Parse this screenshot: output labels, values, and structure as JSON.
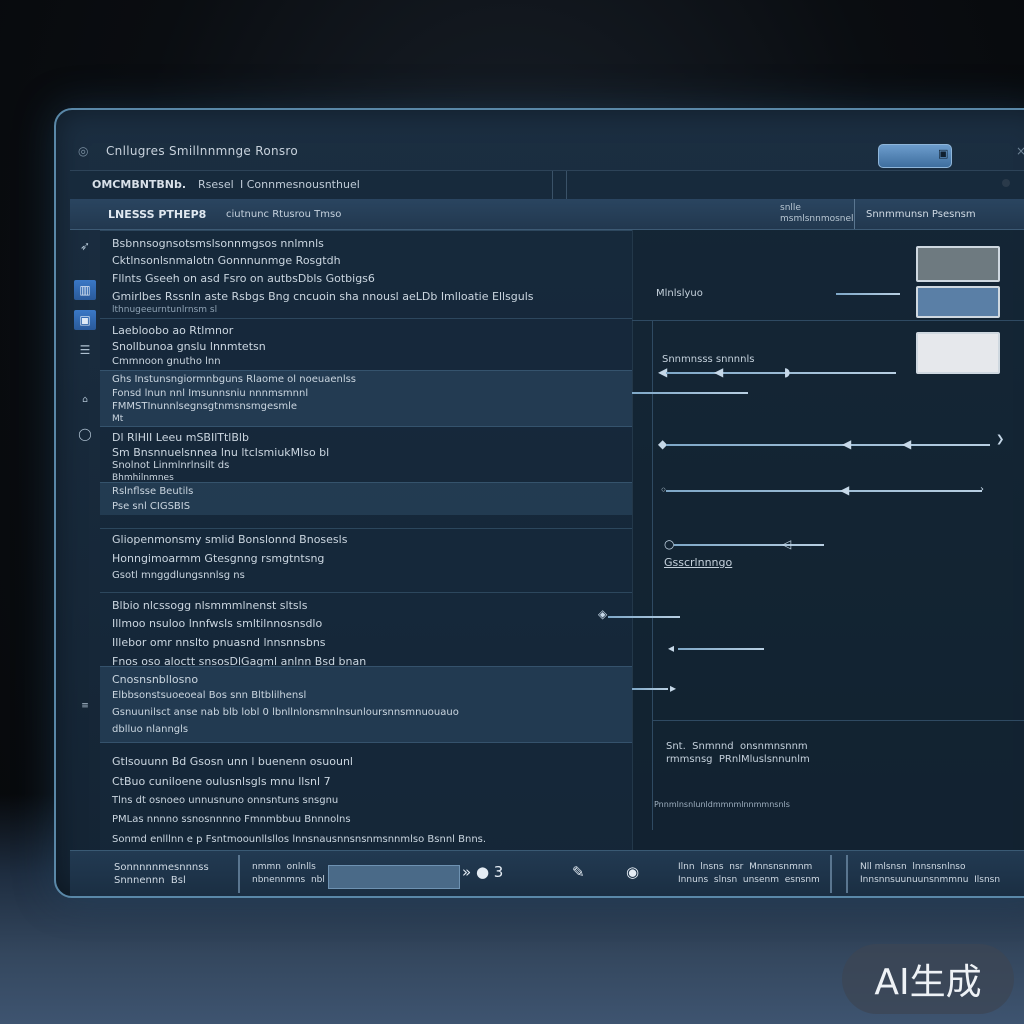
{
  "window": {
    "title": "Cnllugres Smillnnmnge Ronsro",
    "close_glyph": "×"
  },
  "menubar": {
    "item1": "OMCMBNTBNb.",
    "item2": "Rsesel",
    "item3": "I Connmesnousnthuel"
  },
  "toolbar": {
    "label1": "LNESSS PTHEP8",
    "label2": "ciutnunc Rtusrou Tmso",
    "label3": "snlle\nmsmlsnnmosnel",
    "label4": "Snnmmunsn Psesnsm"
  },
  "leftbar": {
    "icons": [
      "pointer-icon",
      "chart-icon",
      "image-icon",
      "list-icon",
      "home-icon",
      "circle-icon",
      "menu-icon"
    ]
  },
  "leftpane": {
    "rows": [
      {
        "lines": [
          "Bsbnnsognsotsmslsonnmgsos nnlmnls",
          "Cktlnsonlsnmalotn Gonnnunmge Rosgtdh",
          "Fllnts Gseeh on asd  Fsro  on autbsDbls  Gotbigs6",
          "Gmirlbes Rssnln aste Rsbgs Bng  cncuoin sha nnousl aeLDb  Imlloatie  Ellsguls",
          "lthnugeeurntunlrnsm  sl"
        ]
      },
      {
        "lines": [
          "Laebloobo ao  Rtlmnor",
          "Snollbunoa gnslu  lnnmtetsn",
          "Cmmnoon gnutho  lnn"
        ]
      },
      {
        "lines": [
          "Ghs  Instunsngiormnbguns  Rlaome  ol noeuaenlss",
          "Fonsd lnun  nnl  Imsunnsniu nnnmsmnnl",
          "FMMSTInunnlsegnsgtnmsnsmgesmle",
          "Mt"
        ]
      },
      {
        "lines": [
          "Dl  RlHlI Leeu  mSBIlTtlBlb",
          "Sm Bnsnnuelsnnea  lnu  ltclsmiukMlso  bl",
          "Snolnot Linmlnrlnsilt ds",
          "Bhmhilnmnes"
        ]
      },
      {
        "lines": [
          "Rslnflsse Beutils",
          "Pse  snl  CIGSBIS"
        ]
      },
      {
        "lines": [
          "Gliopenmonsmy  smlid  Bonslonnd  Bnosesls",
          "Honngimoarmm  Gtesgnng  rsmgtntsng",
          "Gsotl  mnggdlungsnnlsg  ns"
        ]
      },
      {
        "lines": [
          "Blbio  nlcssogg  nlsmmmlnenst sltsls",
          "Illmoo  nsuloo  lnnfwsls  smltilnnosnsdlo",
          "Illebor  omr  nnslto  pnuasnd  lnnsnnsbns",
          "Fnos oso aloctt  snsosDlGagml anlnn  Bsd  bnan",
          "Cnosnsnbllosno"
        ]
      },
      {
        "lines": [
          "Elbbsonstsuoeoeal Bos  snn  Bltblilhensl",
          "Gsnuunilsct anse nab blb  lobl  0  lbnllnlonsmnlnsunloursnnsmnuouauo",
          "dblluo nlanngls"
        ]
      },
      {
        "lines": [
          "Gtlsouunn  Bd  Gsosn  unn  l  buenenn  osuounl",
          "CtBuo  cuniloene  oulusnlsgls  mnu  llsnl  7",
          "Tlns  dt  osnoeo  unnusnuno  onnsntuns  snsgnu",
          "PMLas nnnno ssnosnnnno  Fmnmbbuu  Bnnnolns",
          "Sonmd enlllnn  e  p  Fsntmoounllsllos lnnsnausnnsnsnmsnnmlso  Bsnnl  Bnns."
        ]
      }
    ]
  },
  "rightpane": {
    "label_top": "Mlnlslyuo",
    "label_sliders": "Snnmnsss  snnnnls",
    "label_gsc": "Gsscrlnnngo",
    "label_bottom": "Snt.  Snmnnd  onsnmnsnnm\nrmmsnsg  PRnlMluslsnnunlm",
    "label_footer": "Pnnmlnsnlunldmmnmlnnmmnsnls",
    "swatch_colors": [
      "#6e7a80",
      "#5a7fa6",
      "#e6e8ec"
    ],
    "accent": "#8fb6da"
  },
  "statusbar": {
    "left": "Sonnnnnmesnnnss\nSnnnennn  Bsl",
    "mid": "nmmn  onlnlls\nnbnennmns  nbl",
    "icons_text": "»  ●  3",
    "right1": "Ilnn  lnsns  nsr  Mnnsnsnmnm\nInnuns  slnsn  unsenm  esnsnm",
    "right2": "Nll mlsnsn  lnnsnsnlnso\nInnsnnsuunuunsnmmnu  Ilsnsn"
  },
  "watermark": "AI生成"
}
